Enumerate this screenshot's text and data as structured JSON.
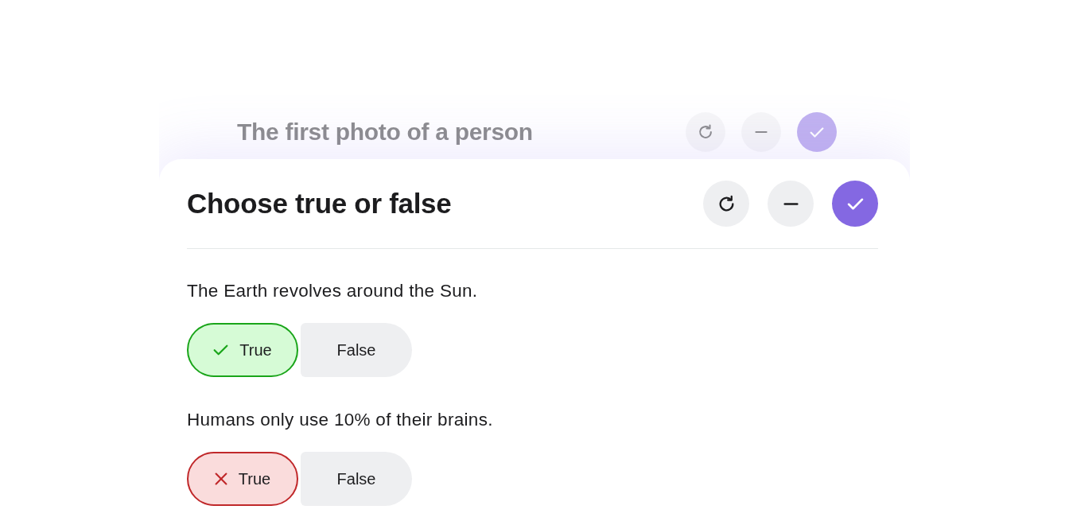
{
  "cards": [
    {
      "title": "The first photo of a person",
      "active": false
    },
    {
      "title": "Choose true or false",
      "active": true,
      "questions": [
        {
          "statement": "The Earth revolves around the Sun.",
          "answered_correctly": true,
          "options": [
            {
              "label": "True",
              "selected": true
            },
            {
              "label": "False",
              "selected": false
            }
          ]
        },
        {
          "statement": "Humans only use 10% of their brains.",
          "answered_correctly": false,
          "options": [
            {
              "label": "True",
              "selected": true
            },
            {
              "label": "False",
              "selected": false
            }
          ]
        }
      ]
    }
  ]
}
